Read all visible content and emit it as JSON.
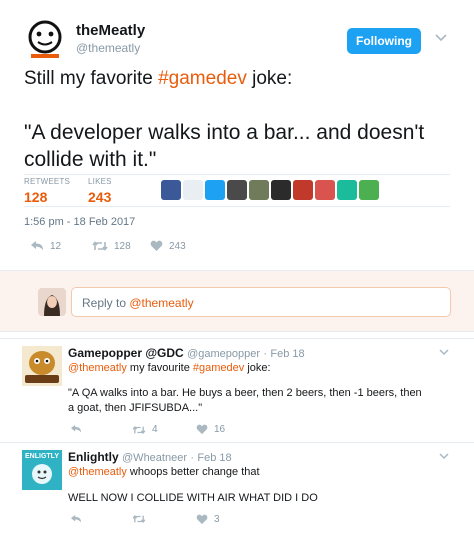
{
  "main_tweet": {
    "author_name": "theMeatly",
    "author_handle": "@themeatly",
    "follow_label": "Following",
    "text_before": "Still my favorite ",
    "hashtag": "#gamedev",
    "text_after": " joke:",
    "quote": "\"A developer walks into a bar... and doesn't collide with it.\"",
    "retweets_label": "RETWEETS",
    "retweets_count": "128",
    "likes_label": "LIKES",
    "likes_count": "243",
    "timestamp": "1:56 pm - 18 Feb 2017",
    "actions": {
      "reply_count": "12",
      "retweet_count": "128",
      "like_count": "243"
    },
    "likers": [
      "#3b5998",
      "#e9eef2",
      "#1da1f2",
      "#4a4a4a",
      "#6f7b5a",
      "#2b2b2b",
      "#c0392b",
      "#d9534f",
      "#1abc9c",
      "#4caf50"
    ]
  },
  "reply_box": {
    "prefix": "Reply to ",
    "mention": "@themeatly"
  },
  "replies": [
    {
      "name": "Gamepopper @GDC",
      "handle": "@gamepopper",
      "date": "Feb 18",
      "mention": "@themeatly",
      "line1_text": " my favourite ",
      "line1_hashtag": "#gamedev",
      "line1_end": " joke:",
      "body": "\"A QA walks into a bar. He buys a beer, then 2 beers, then -1 beers, then a goat, then JFIFSUBDA...\"",
      "reply_count": "",
      "retweet_count": "4",
      "like_count": "16"
    },
    {
      "name": "Enlightly",
      "handle": "@Wheatneer",
      "date": "Feb 18",
      "mention": "@themeatly",
      "line1_text": " whoops better change that",
      "body": "WELL NOW I COLLIDE WITH AIR WHAT DID I DO",
      "avatar_text": "ENLIGTLY",
      "reply_count": "",
      "retweet_count": "",
      "like_count": "3"
    }
  ]
}
